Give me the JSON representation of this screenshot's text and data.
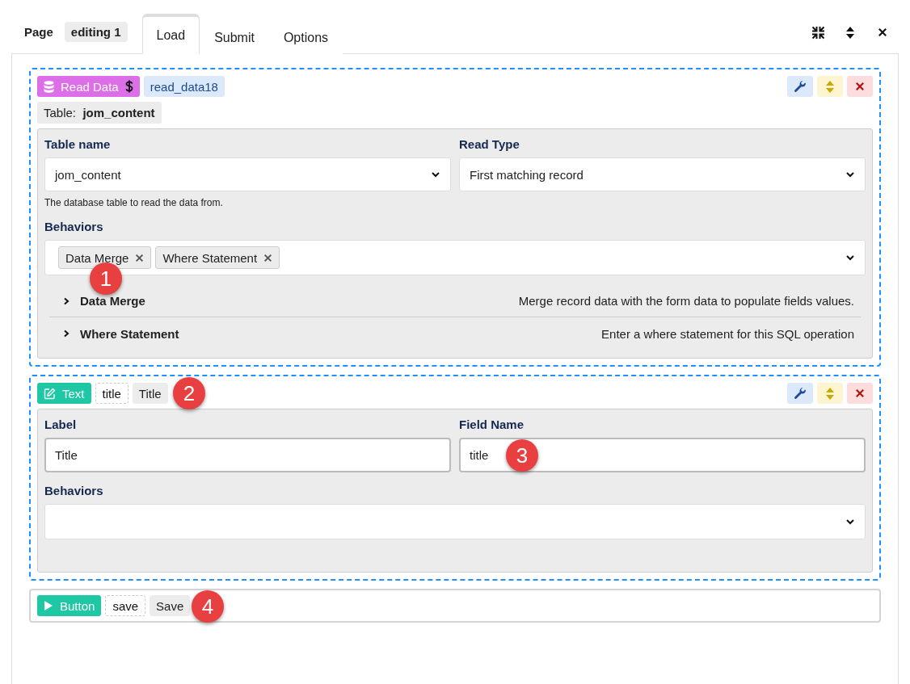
{
  "header": {
    "title": "Page",
    "badge": "editing 1"
  },
  "tabs": [
    {
      "label": "Load",
      "selected": true
    },
    {
      "label": "Submit",
      "selected": false
    },
    {
      "label": "Options",
      "selected": false
    }
  ],
  "blocks": [
    {
      "kind": "read_data",
      "type_label": "Read Data",
      "name": "read_data18",
      "table_label": "Table:",
      "table_value": "jom_content",
      "rows": [
        [
          {
            "kind": "select",
            "label": "Table name",
            "value": "jom_content",
            "hint": "The database table to read the data from."
          },
          {
            "kind": "select",
            "label": "Read Type",
            "value": "First matching record"
          }
        ]
      ],
      "behaviors": {
        "label": "Behaviors",
        "chips": [
          {
            "label": "Data Merge",
            "callout": "1"
          },
          {
            "label": "Where Statement"
          }
        ],
        "panels": [
          {
            "title": "Data Merge",
            "description": "Merge record data with the form data to populate fields values.",
            "expanded": false
          },
          {
            "title": "Where Statement",
            "description": "Enter a where statement for this SQL operation",
            "expanded": false
          }
        ]
      }
    },
    {
      "kind": "text",
      "type_label": "Text",
      "name": "title",
      "title": "Title",
      "callout": "2",
      "rows": [
        [
          {
            "kind": "input",
            "label": "Label",
            "value": "Title"
          },
          {
            "kind": "input",
            "label": "Field Name",
            "value": "title",
            "callout": "3"
          }
        ]
      ],
      "behaviors": {
        "label": "Behaviors"
      }
    },
    {
      "kind": "button",
      "type_label": "Button",
      "name": "save",
      "title": "Save",
      "callout": "4"
    }
  ]
}
